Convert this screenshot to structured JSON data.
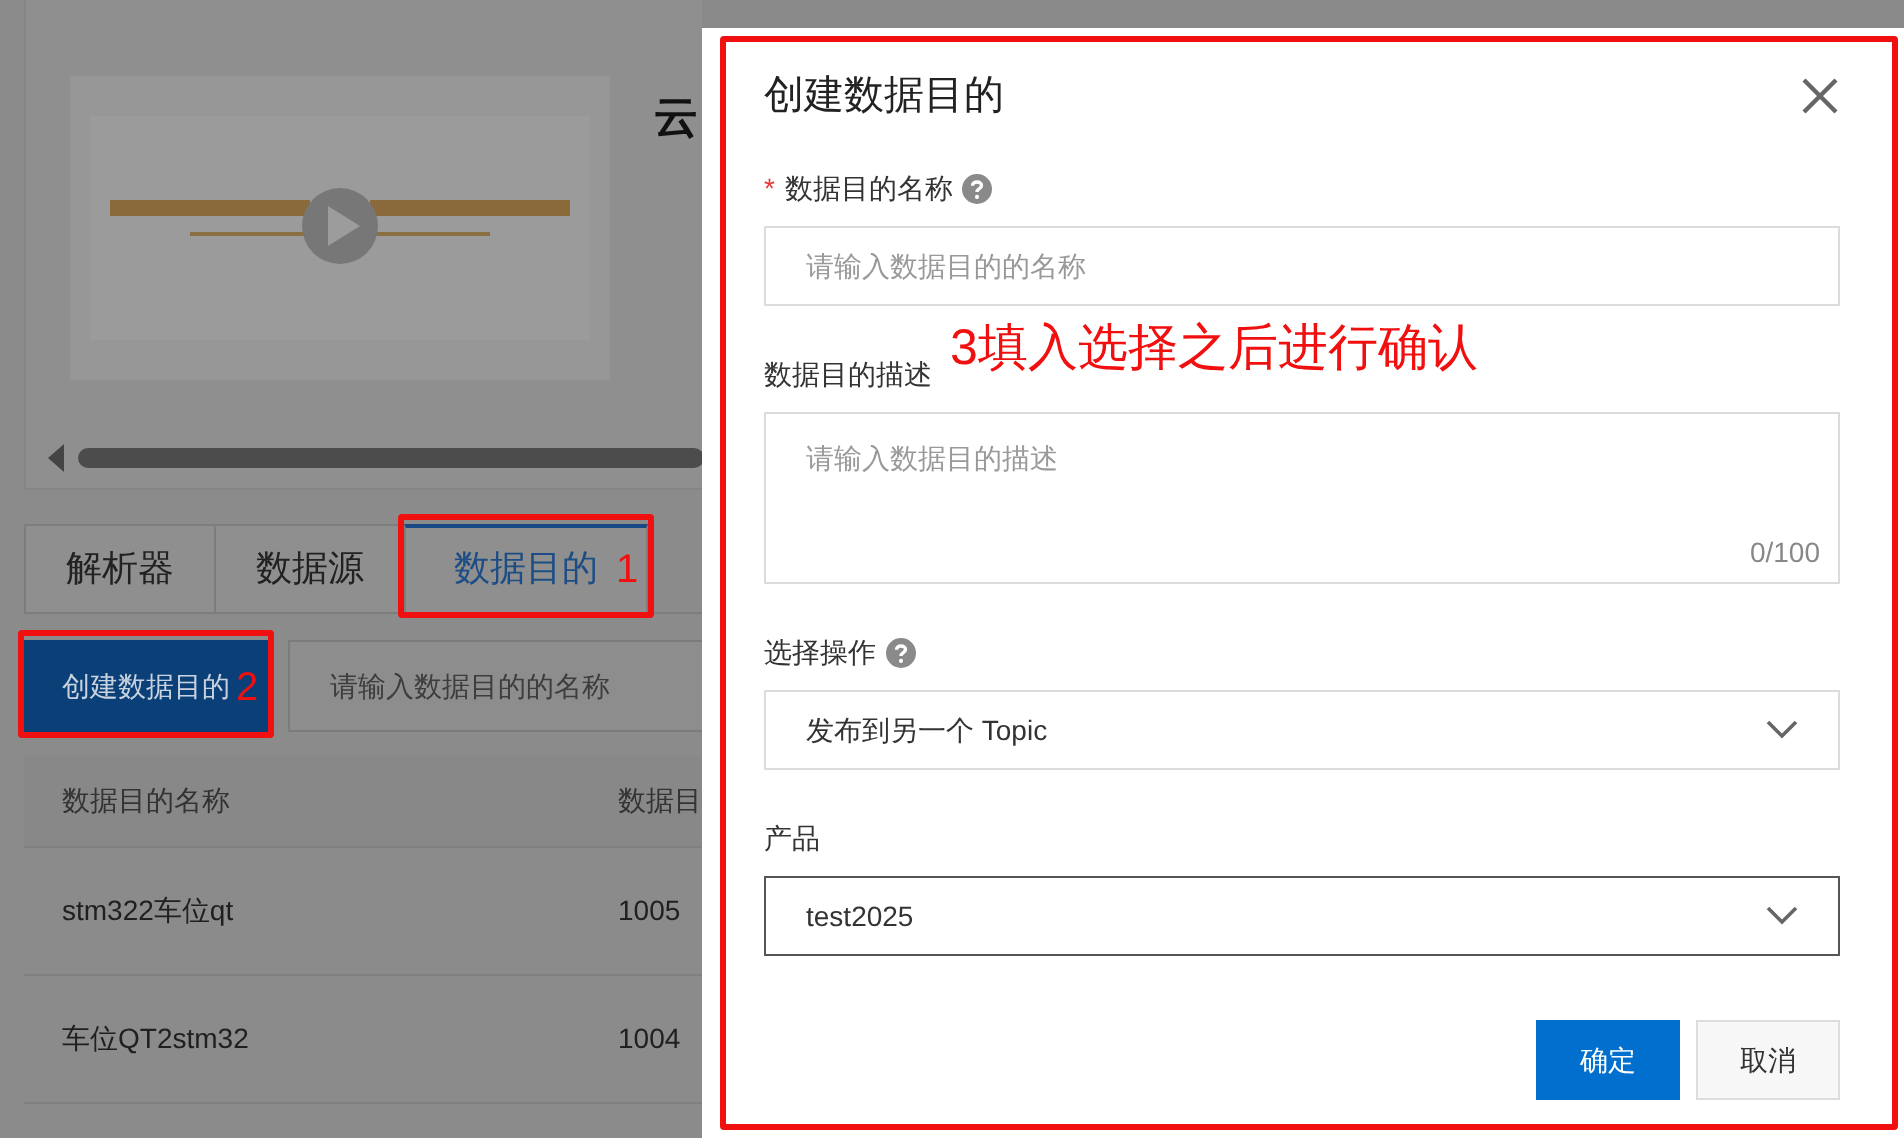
{
  "page": {
    "title_fragment": "云",
    "tabs": [
      {
        "label": "解析器",
        "selected": false
      },
      {
        "label": "数据源",
        "selected": false
      },
      {
        "label": "数据目的",
        "selected": true,
        "annotation": "1"
      }
    ],
    "create_button": {
      "label": "创建数据目的",
      "annotation": "2"
    },
    "search": {
      "placeholder": "请输入数据目的的名称"
    },
    "table": {
      "columns": [
        "数据目的名称",
        "数据目"
      ],
      "rows": [
        [
          "stm322车位qt",
          "1005"
        ],
        [
          "车位QT2stm32",
          "1004"
        ]
      ]
    }
  },
  "dialog": {
    "title": "创建数据目的",
    "annotation": "3填入选择之后进行确认",
    "fields": [
      {
        "kind": "input",
        "label": "数据目的名称",
        "required_mark": "*",
        "help": true,
        "placeholder": "请输入数据目的的名称"
      },
      {
        "kind": "textarea",
        "label": "数据目的描述",
        "help": false,
        "placeholder": "请输入数据目的描述",
        "counter": "0/100"
      },
      {
        "kind": "select",
        "label": "选择操作",
        "help": true,
        "value": "发布到另一个 Topic",
        "focused": false
      },
      {
        "kind": "select",
        "label": "产品",
        "help": false,
        "value": "test2025",
        "focused": true
      }
    ],
    "buttons": [
      {
        "label": "确定",
        "primary": true
      },
      {
        "label": "取消",
        "primary": false
      }
    ]
  }
}
